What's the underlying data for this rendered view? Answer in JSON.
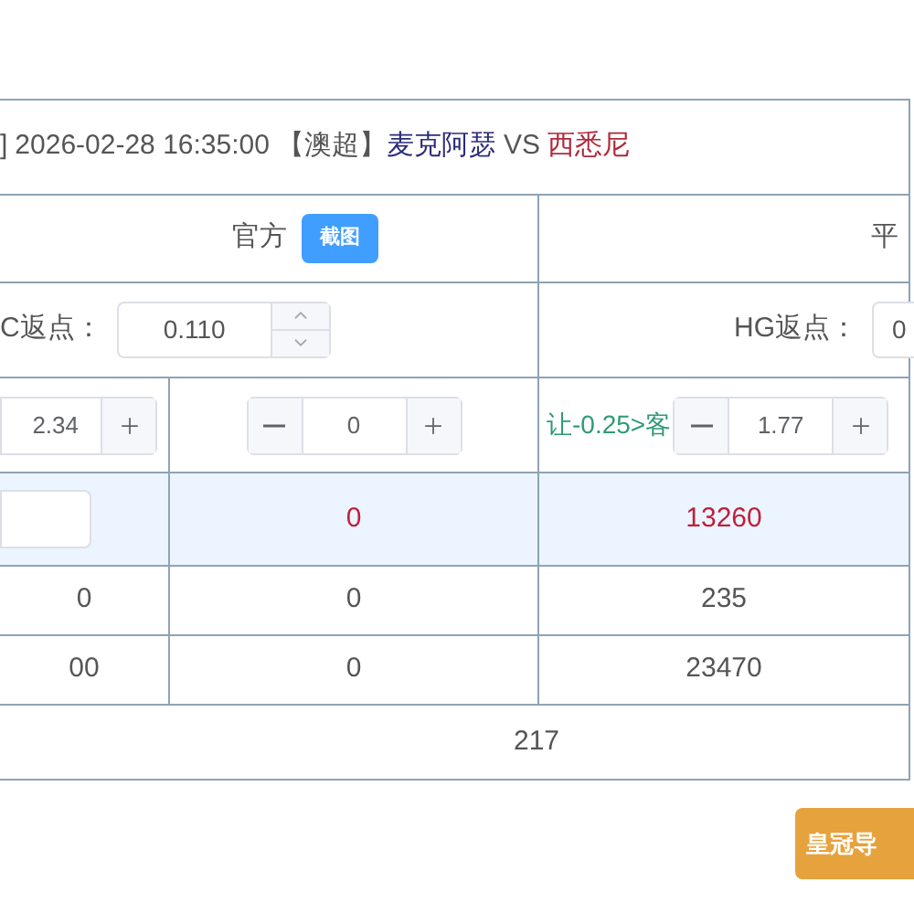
{
  "match": {
    "prefix": "]",
    "time": "2026-02-28 16:35:00",
    "league": "【澳超】",
    "home": "麦克阿瑟",
    "vs": "VS",
    "away": "西悉尼"
  },
  "sources": [
    {
      "label": "官方",
      "button": "截图"
    },
    {
      "label": "平"
    }
  ],
  "rebates": [
    {
      "label": "C返点：",
      "value": "0.110"
    },
    {
      "label": "HG返点：",
      "value": "0"
    }
  ],
  "odds": [
    {
      "kind": "plus",
      "value": "2.34"
    },
    {
      "kind": "stepper",
      "value": "0"
    },
    {
      "kind": "handicap",
      "label": "让-0.25>客",
      "value": "1.77"
    }
  ],
  "rows": [
    {
      "selected": true,
      "cells": [
        {
          "kind": "input"
        },
        {
          "kind": "text",
          "text": "0"
        },
        {
          "kind": "text",
          "text": "13260"
        }
      ]
    },
    {
      "selected": false,
      "cells": [
        {
          "kind": "text",
          "text": "0"
        },
        {
          "kind": "text",
          "text": "0"
        },
        {
          "kind": "text",
          "text": "235"
        }
      ]
    },
    {
      "selected": false,
      "cells": [
        {
          "kind": "text",
          "text": "00"
        },
        {
          "kind": "text",
          "text": "0"
        },
        {
          "kind": "text",
          "text": "23470"
        }
      ]
    }
  ],
  "total": "217",
  "nav_button": "皇冠导"
}
